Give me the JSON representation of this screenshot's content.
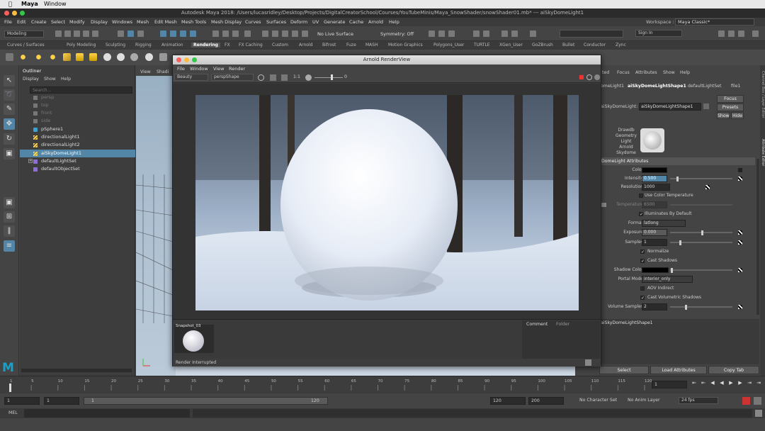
{
  "mac_menu": {
    "app": "Maya",
    "window": "Window"
  },
  "window_title": "Autodesk Maya 2018: /Users/lucasridley/Desktop/Projects/DigitalCreatorSchool/Courses/YouTubeMinis/Maya_SnowShader/snowShader01.mb*   ---   aiSkyDomeLight1",
  "menus": [
    "File",
    "Edit",
    "Create",
    "Select",
    "Modify",
    "Display",
    "Windows",
    "Mesh",
    "Edit Mesh",
    "Mesh Tools",
    "Mesh Display",
    "Curves",
    "Surfaces",
    "Deform",
    "UV",
    "Generate",
    "Cache",
    "Arnold",
    "Help"
  ],
  "workspace": {
    "label": "Workspace :",
    "value": "Maya Classic*"
  },
  "status": {
    "menu_set": "Modeling",
    "live_surface": "No Live Surface",
    "symmetry": "Symmetry: Off",
    "sign_in": "Sign In"
  },
  "shelf_tabs": [
    "Curves / Surfaces",
    "Poly Modeling",
    "Sculpting",
    "Rigging",
    "Animation",
    "Rendering",
    "FX",
    "FX Caching",
    "Custom",
    "Arnold",
    "Bifrost",
    "Fuze",
    "MASH",
    "Motion Graphics",
    "Polygons_User",
    "TURTLE",
    "XGen_User",
    "GoZBrush",
    "Bullet",
    "Conductor",
    "Zync"
  ],
  "active_shelf": "Rendering",
  "outliner": {
    "title": "Outliner",
    "menu": [
      "Display",
      "Show",
      "Help"
    ],
    "search_placeholder": "Search...",
    "items": [
      {
        "label": "persp",
        "dim": true
      },
      {
        "label": "top",
        "dim": true
      },
      {
        "label": "front",
        "dim": true
      },
      {
        "label": "side",
        "dim": true
      },
      {
        "label": "pSphere1",
        "dim": false
      },
      {
        "label": "directionalLight1",
        "dim": false
      },
      {
        "label": "directionalLight2",
        "dim": false
      },
      {
        "label": "aiSkyDomeLight1",
        "dim": false,
        "selected": true
      },
      {
        "label": "defaultLightSet",
        "dim": false
      },
      {
        "label": "defaultObjectSet",
        "dim": false
      }
    ]
  },
  "viewport_menu": [
    "View",
    "Shadi"
  ],
  "render_view": {
    "title": "Arnold RenderView",
    "menu": [
      "File",
      "Window",
      "View",
      "Render"
    ],
    "aov": "Beauty",
    "camera": "perspShape",
    "ratio": "1:1",
    "exposure": "0",
    "snapshot_label": "Snapshot_03",
    "tabs": [
      "Comment",
      "Folder"
    ],
    "status": "Render Interrupted"
  },
  "attribute_editor": {
    "menu": [
      "Focus",
      "Attributes",
      "Show",
      "Help"
    ],
    "tabs": [
      "cted",
      "omeLight1",
      "aiSkyDomeLightShape1",
      "defaultLightSet",
      "file1"
    ],
    "node_label": "aiSkyDomeLight:",
    "node_value": "aiSkyDomeLightShape1",
    "focus_btn": "Focus",
    "presets_btn": "Presets",
    "show_btn": "Show",
    "hide_btn": "Hide",
    "classification": [
      "Drawdb",
      "Geometry",
      "Light",
      "Arnold",
      "Skydome"
    ],
    "section": "DomeLight Attributes",
    "color_label": "Color",
    "intensity_label": "Intensity",
    "intensity": "0.500",
    "resolution_label": "Resolution",
    "resolution": "1000",
    "use_color_temp": "Use Color Temperature",
    "temperature_label": "Temperature",
    "temperature": "6500",
    "illuminates": "Illuminates By Default",
    "format_label": "Format",
    "format": "latlong",
    "exposure_label": "Exposure",
    "exposure": "0.000",
    "samples_label": "Samples",
    "samples": "1",
    "normalize": "Normalize",
    "cast_shadows": "Cast Shadows",
    "shadow_color_label": "Shadow Color",
    "portal_label": "Portal Mode",
    "portal": "interior_only",
    "aov_indirect": "AOV Indirect",
    "cast_vol": "Cast Volumetric Shadows",
    "vol_samples_label": "Volume Samples",
    "vol_samples": "2",
    "notes_label": "aiSkyDomeLightShape1",
    "select_btn": "Select",
    "load_btn": "Load Attributes",
    "copy_btn": "Copy Tab"
  },
  "side_tabs": [
    "Channel Box / Layer Editor",
    "Attribute Editor"
  ],
  "timeline": {
    "ticks": [
      "1",
      "5",
      "10",
      "15",
      "20",
      "25",
      "30",
      "35",
      "40",
      "45",
      "50",
      "55",
      "60",
      "65",
      "70",
      "75",
      "80",
      "85",
      "90",
      "95",
      "100",
      "105",
      "110",
      "115",
      "120"
    ],
    "current_frame": "1"
  },
  "range": {
    "start": "1",
    "inner_start": "1",
    "range_start": "1",
    "range_end": "120",
    "inner_end": "120",
    "end": "200",
    "character_set": "No Character Set",
    "anim_layer": "No Anim Layer",
    "fps": "24 fps"
  },
  "command_line": {
    "label": "MEL"
  },
  "colors": {
    "selection": "#5285a6",
    "active_tab": "#5285a6",
    "mac_close": "#fc605c",
    "mac_min": "#fdbc40",
    "mac_max": "#34c84a"
  }
}
